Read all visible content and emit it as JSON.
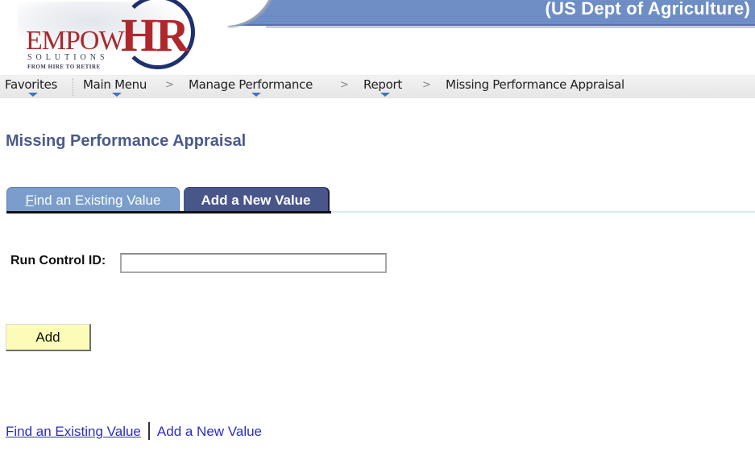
{
  "header": {
    "org_title": "(US Dept of Agriculture)",
    "logo": {
      "brand_part1": "EMPOW",
      "brand_part2": "HR",
      "solutions": "SOLUTIONS",
      "tagline": "FROM HIRE TO RETIRE"
    },
    "colors": {
      "banner": "#6f8fc6",
      "brand_red": "#a62b2e",
      "brand_navy": "#1f2f6f"
    }
  },
  "navbar": {
    "items": [
      {
        "label": "Favorites",
        "has_dropdown": true
      },
      {
        "label": "Main Menu",
        "has_dropdown": true
      },
      {
        "label": "Manage Performance",
        "has_dropdown": true
      },
      {
        "label": "Report",
        "has_dropdown": true
      },
      {
        "label": "Missing Performance Appraisal",
        "has_dropdown": false
      }
    ],
    "separator": ">"
  },
  "page": {
    "title": "Missing Performance Appraisal"
  },
  "tabs": [
    {
      "label_first": "F",
      "label_rest": "ind an Existing Value",
      "active": false
    },
    {
      "label": "Add a New Value",
      "active": true
    }
  ],
  "form": {
    "run_control_label": "Run Control ID:",
    "run_control_value": "",
    "run_control_placeholder": "",
    "add_button_label": "Add"
  },
  "footer_links": {
    "find_existing": "Find an Existing Value",
    "add_new": "Add a New Value"
  }
}
